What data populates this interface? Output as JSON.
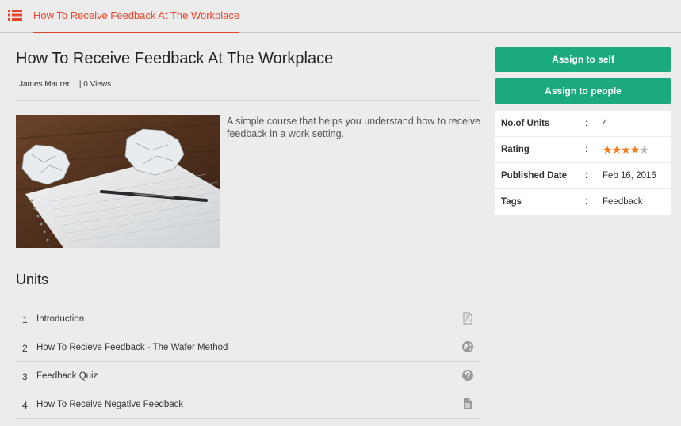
{
  "header": {
    "active_tab": "How To Receive Feedback At The Workplace",
    "menu_icon": "list-icon",
    "accent_color": "#e8442b"
  },
  "course": {
    "title": "How To Receive Feedback At The Workplace",
    "author": "James Maurer",
    "views": "| 0 Views",
    "description": "A simple course that helps you understand how to receive feedback in a work setting."
  },
  "actions": {
    "assign_self_label": "Assign to self",
    "assign_people_label": "Assign to people",
    "button_color": "#1aaa7e"
  },
  "info": {
    "units_label": "No.of Units",
    "units_value": "4",
    "rating_label": "Rating",
    "rating_value": 4,
    "rating_max": 5,
    "published_label": "Published Date",
    "published_value": "Feb 16, 2016",
    "tags_label": "Tags",
    "tags_value": "Feedback",
    "colon": ":"
  },
  "units": {
    "heading": "Units",
    "items": [
      {
        "num": "1",
        "title": "Introduction",
        "icon": "pdf-file-icon"
      },
      {
        "num": "2",
        "title": "How To Recieve Feedback - The Wafer Method",
        "icon": "globe-icon"
      },
      {
        "num": "3",
        "title": "Feedback Quiz",
        "icon": "question-circle-icon"
      },
      {
        "num": "4",
        "title": "How To Receive Negative Feedback",
        "icon": "document-icon"
      }
    ]
  }
}
